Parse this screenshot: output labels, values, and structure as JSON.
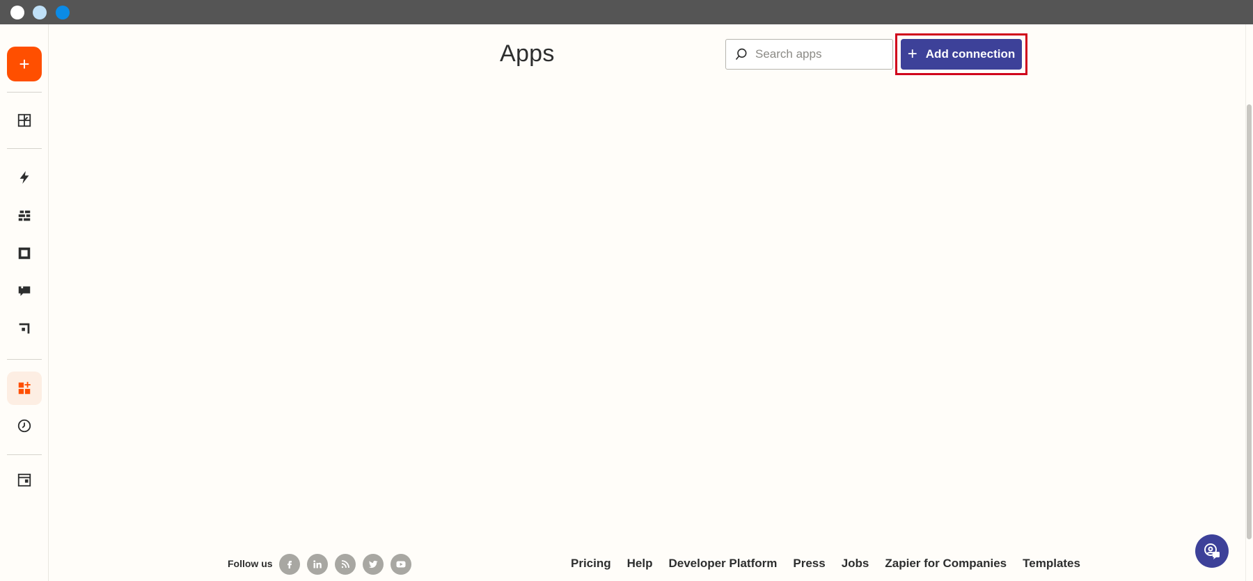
{
  "window": {
    "controls": [
      "close",
      "minimize",
      "maximize"
    ]
  },
  "sidebar": {
    "create_label": "+",
    "items": [
      {
        "name": "dashboard-icon"
      },
      {
        "name": "zaps-icon"
      },
      {
        "name": "tables-icon"
      },
      {
        "name": "interfaces-icon"
      },
      {
        "name": "chatbots-icon"
      },
      {
        "name": "canvas-icon"
      },
      {
        "name": "apps-icon",
        "active": true
      },
      {
        "name": "history-icon"
      },
      {
        "name": "admin-icon"
      }
    ],
    "accent": "#ff4f00"
  },
  "main": {
    "title": "Apps",
    "search": {
      "placeholder": "Search apps",
      "value": ""
    },
    "add_button": {
      "icon": "+",
      "label": "Add connection",
      "color": "#3d4199"
    }
  },
  "footer": {
    "follow_label": "Follow us",
    "social": [
      "facebook-icon",
      "linkedin-icon",
      "rss-icon",
      "twitter-icon",
      "youtube-icon"
    ],
    "links": [
      "Pricing",
      "Help",
      "Developer Platform",
      "Press",
      "Jobs",
      "Zapier for Companies",
      "Templates"
    ]
  },
  "help_fab": {
    "icon": "help-chat-icon"
  }
}
